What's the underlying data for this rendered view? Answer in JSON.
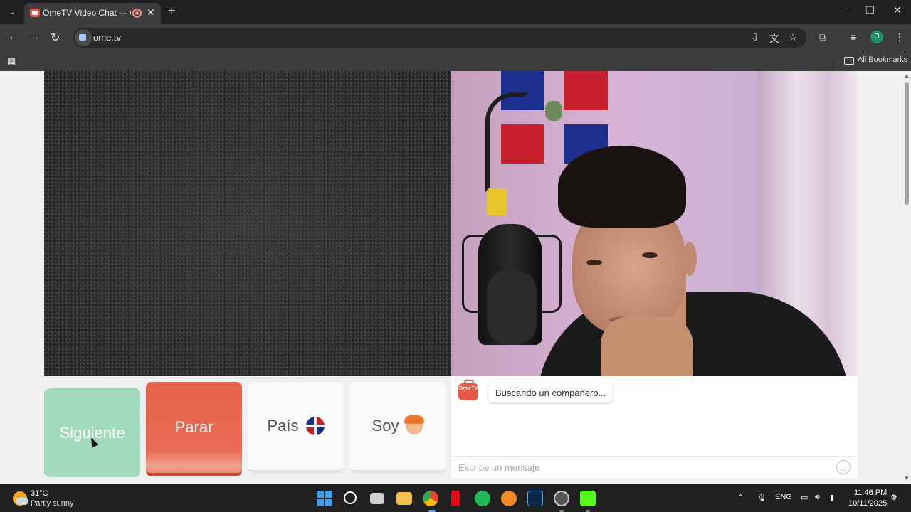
{
  "browser": {
    "tab_title": "OmeTV Video Chat — Ome",
    "url": "ome.tv",
    "bookmarks_label": "All Bookmarks",
    "profile_initial": "O"
  },
  "page": {
    "buttons": {
      "next": "Siguiente",
      "stop": "Parar",
      "country": "País",
      "gender": "Soy"
    },
    "chat": {
      "logo_text": "Ome TV",
      "status_message": "Buscando un compañero...",
      "input_placeholder": "Escribe un mensaje"
    },
    "selected_country_flag": "dominican-republic-flag",
    "selected_gender_icon": "boy-icon"
  },
  "taskbar": {
    "weather_temp": "31°C",
    "weather_desc": "Partly sunny",
    "language": "ENG",
    "time": "11:46 PM",
    "date": "10/11/2025"
  },
  "colors": {
    "next_button": "#a3d9bd",
    "stop_button": "#e5624c",
    "accent_logo": "#e15b48"
  }
}
